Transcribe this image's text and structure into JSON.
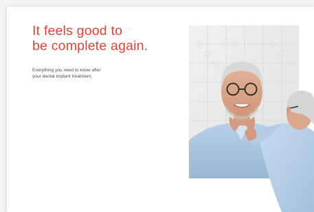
{
  "headline": {
    "line1": "It feels good to",
    "line2": "be complete again."
  },
  "subtext": {
    "line1": "Everything you need to know after",
    "line2": "your dental implant treatment."
  },
  "colors": {
    "accent": "#e6412f",
    "text": "#4a4a4a",
    "background": "#ffffff"
  },
  "image": {
    "subject": "puzzle-mirror-portrait"
  }
}
